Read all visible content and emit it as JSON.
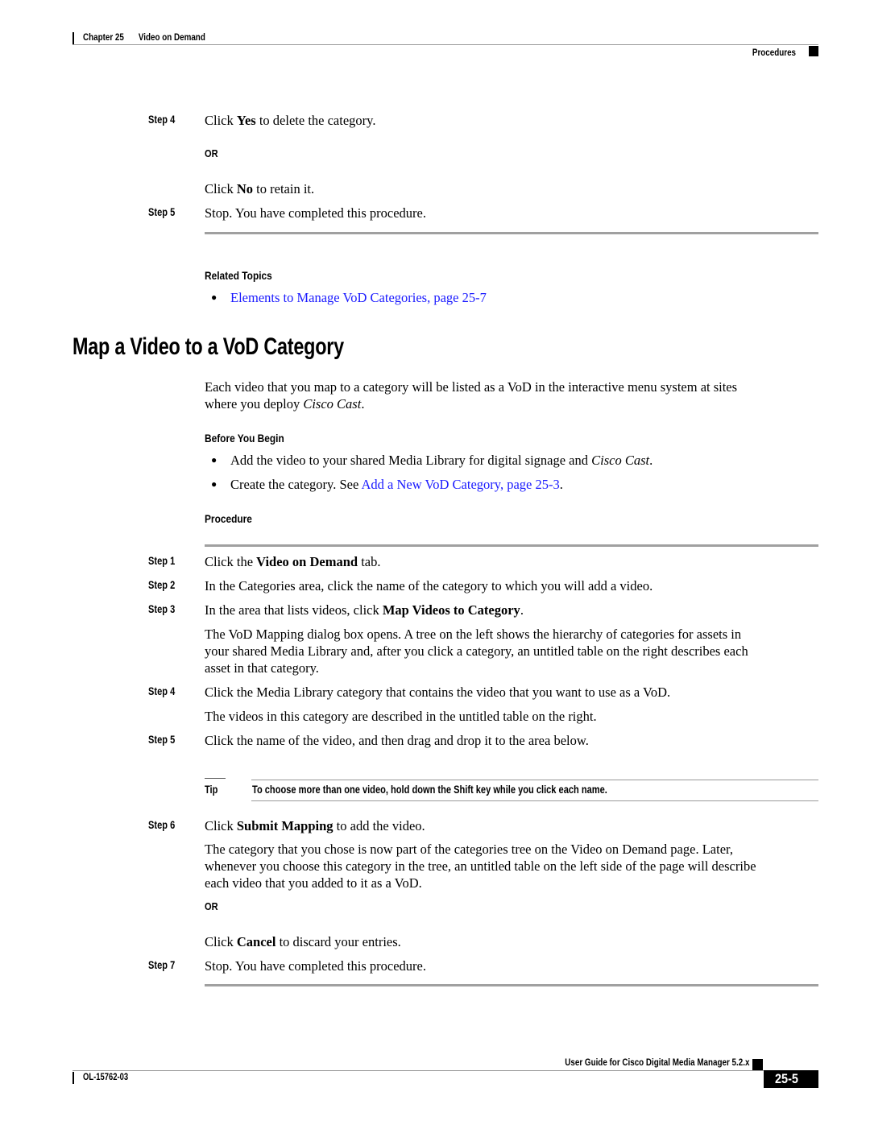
{
  "header": {
    "chapter": "Chapter 25",
    "chapter_title": "Video on Demand",
    "section": "Procedures"
  },
  "prev_procedure": {
    "steps": [
      {
        "label": "Step 4",
        "pre": "Click ",
        "bold": "Yes",
        "post": " to delete the category."
      },
      {
        "or": "OR"
      },
      {
        "pre": "Click ",
        "bold": "No",
        "post": " to retain it."
      },
      {
        "label": "Step 5",
        "text": "Stop. You have completed this procedure."
      }
    ],
    "related_topics": {
      "heading": "Related Topics",
      "links": [
        {
          "text": "Elements to Manage VoD Categories, page 25-7"
        }
      ]
    }
  },
  "section": {
    "title": "Map a Video to a VoD Category",
    "intro": {
      "line1": "Each video that you map to a category will be listed as a VoD in the interactive menu system at sites",
      "line2_pre": "where you deploy ",
      "line2_italic": "Cisco Cast",
      "line2_post": "."
    },
    "before_you_begin": {
      "heading": "Before You Begin",
      "bullets": [
        {
          "pre": "Add the video to your shared Media Library for digital signage and ",
          "italic": "Cisco Cast",
          "post": "."
        },
        {
          "pre": "Create the category. See ",
          "link": "Add a New VoD Category, page 25-3",
          "post": "."
        }
      ]
    },
    "procedure": {
      "heading": "Procedure",
      "steps": [
        {
          "label": "Step 1",
          "pre": "Click the ",
          "bold": "Video on Demand",
          "post": " tab."
        },
        {
          "label": "Step 2",
          "text": "In the Categories area, click the name of the category to which you will add a video."
        },
        {
          "label": "Step 3",
          "pre": "In the area that lists videos, click ",
          "bold": "Map Videos to Category",
          "post": ".",
          "detail": [
            "The VoD Mapping dialog box opens. A tree on the left shows the hierarchy of categories for assets in",
            "your shared Media Library and, after you click a category, an untitled table on the right describes each",
            "asset in that category."
          ]
        },
        {
          "label": "Step 4",
          "text": "Click the Media Library category that contains the video that you want to use as a VoD.",
          "detail": [
            "The videos in this category are described in the untitled table on the right."
          ]
        },
        {
          "label": "Step 5",
          "text": "Click the name of the video, and then drag and drop it to the area below."
        },
        {
          "label": "Step 6",
          "pre": "Click ",
          "bold": "Submit Mapping",
          "post": " to add the video.",
          "detail": [
            "The category that you chose is now part of the categories tree on the Video on Demand page. Later,",
            "whenever you choose this category in the tree, an untitled table on the left side of the page will describe",
            "each video that you added to it as a VoD."
          ],
          "or": "OR",
          "alt_pre": "Click ",
          "alt_bold": "Cancel",
          "alt_post": " to discard your entries."
        },
        {
          "label": "Step 7",
          "text": "Stop. You have completed this procedure."
        }
      ],
      "tip": {
        "label": "Tip",
        "text": "To choose more than one video, hold down the Shift key while you click each name."
      }
    }
  },
  "footer": {
    "guide_title": "User Guide for Cisco Digital Media Manager 5.2.x",
    "doc_number": "OL-15762-03",
    "page_number": "25-5"
  }
}
